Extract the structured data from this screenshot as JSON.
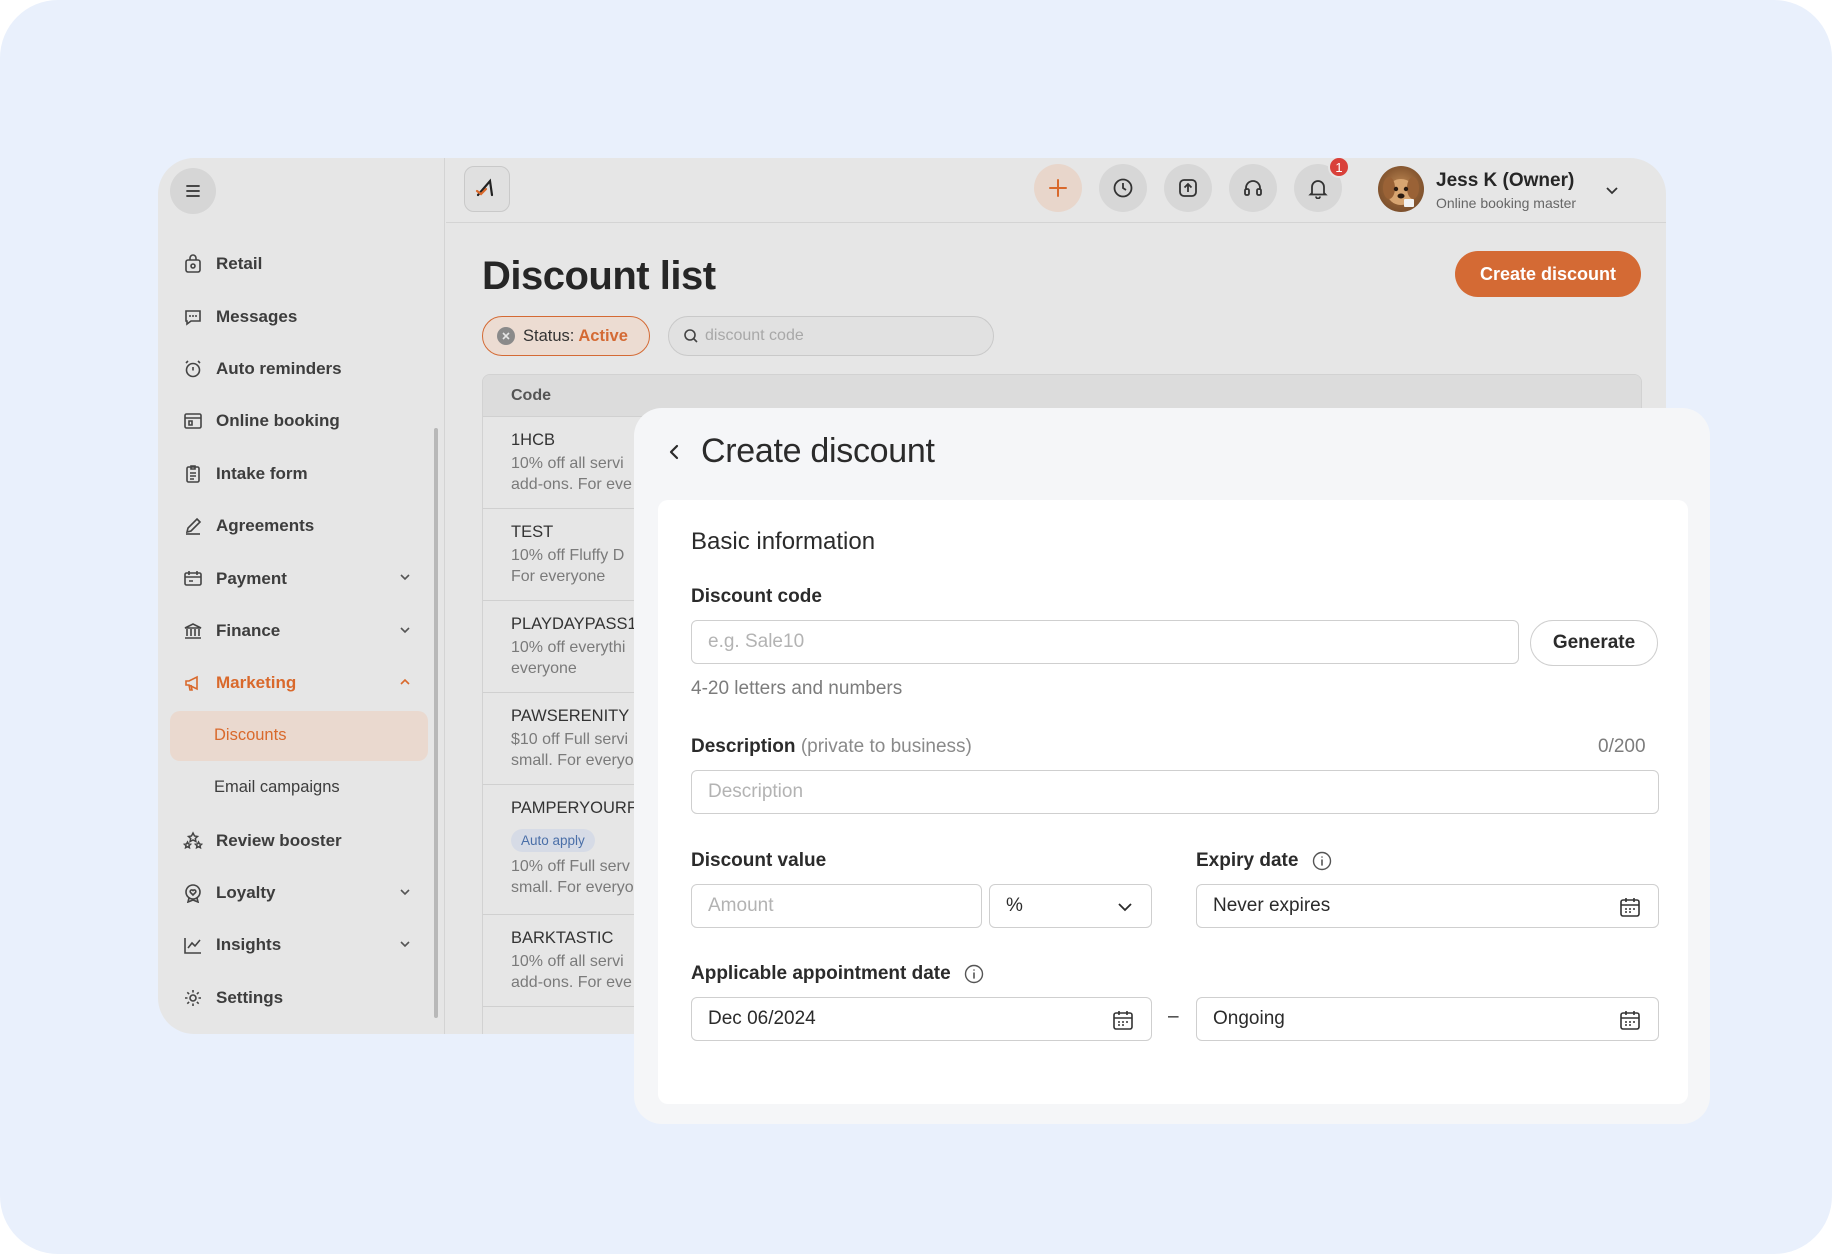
{
  "sidebar": {
    "items": [
      {
        "label": "Retail",
        "icon": "retail-bag-icon"
      },
      {
        "label": "Messages",
        "icon": "message-icon"
      },
      {
        "label": "Auto reminders",
        "icon": "alarm-clock-icon"
      },
      {
        "label": "Online booking",
        "icon": "online-booking-icon"
      },
      {
        "label": "Intake form",
        "icon": "clipboard-icon"
      },
      {
        "label": "Agreements",
        "icon": "pen-icon"
      },
      {
        "label": "Payment",
        "icon": "payment-icon"
      },
      {
        "label": "Finance",
        "icon": "bank-icon"
      },
      {
        "label": "Marketing",
        "icon": "megaphone-icon"
      },
      {
        "label": "Review booster",
        "icon": "stars-icon"
      },
      {
        "label": "Loyalty",
        "icon": "heart-badge-icon"
      },
      {
        "label": "Insights",
        "icon": "chart-line-icon"
      },
      {
        "label": "Settings",
        "icon": "gear-icon"
      }
    ],
    "marketing_sub": [
      {
        "label": "Discounts"
      },
      {
        "label": "Email campaigns"
      }
    ],
    "accent_color": "#d9692c"
  },
  "topbar": {
    "notification_count": "1",
    "user_name": "Jess K (Owner)",
    "user_role": "Online booking master"
  },
  "main": {
    "title": "Discount list",
    "create_button": "Create discount",
    "status_filter_label": "Status:",
    "status_filter_value": "Active",
    "search_placeholder": "discount code",
    "table": {
      "column_code": "Code",
      "rows": [
        {
          "code": "1HCB",
          "desc1": "10% off all servi",
          "desc2": "add-ons. For eve"
        },
        {
          "code": "TEST",
          "desc1": "10% off Fluffy D",
          "desc2": "For everyone"
        },
        {
          "code": "PLAYDAYPASS1",
          "desc1": "10% off everythi",
          "desc2": "everyone"
        },
        {
          "code": "PAWSERENITY",
          "desc1": "$10 off Full servi",
          "desc2": "small. For everyo"
        },
        {
          "code": "PAMPERYOURFU",
          "tag": "Auto apply",
          "desc1": "10% off Full serv",
          "desc2": "small. For everyo"
        },
        {
          "code": "BARKTASTIC",
          "desc1": "10% off all servi",
          "desc2": "add-ons. For eve"
        }
      ]
    }
  },
  "panel": {
    "title": "Create discount",
    "section_title": "Basic information",
    "discount_code_label": "Discount code",
    "discount_code_placeholder": "e.g. Sale10",
    "generate_button": "Generate",
    "code_hint": "4-20 letters and numbers",
    "description_label": "Description",
    "description_note": "(private to business)",
    "description_counter": "0/200",
    "description_placeholder": "Description",
    "discount_value_label": "Discount value",
    "amount_placeholder": "Amount",
    "unit_value": "%",
    "expiry_label": "Expiry date",
    "expiry_value": "Never expires",
    "applicable_label": "Applicable appointment date",
    "start_date": "Dec 06/2024",
    "range_separator": "–",
    "end_date": "Ongoing"
  }
}
